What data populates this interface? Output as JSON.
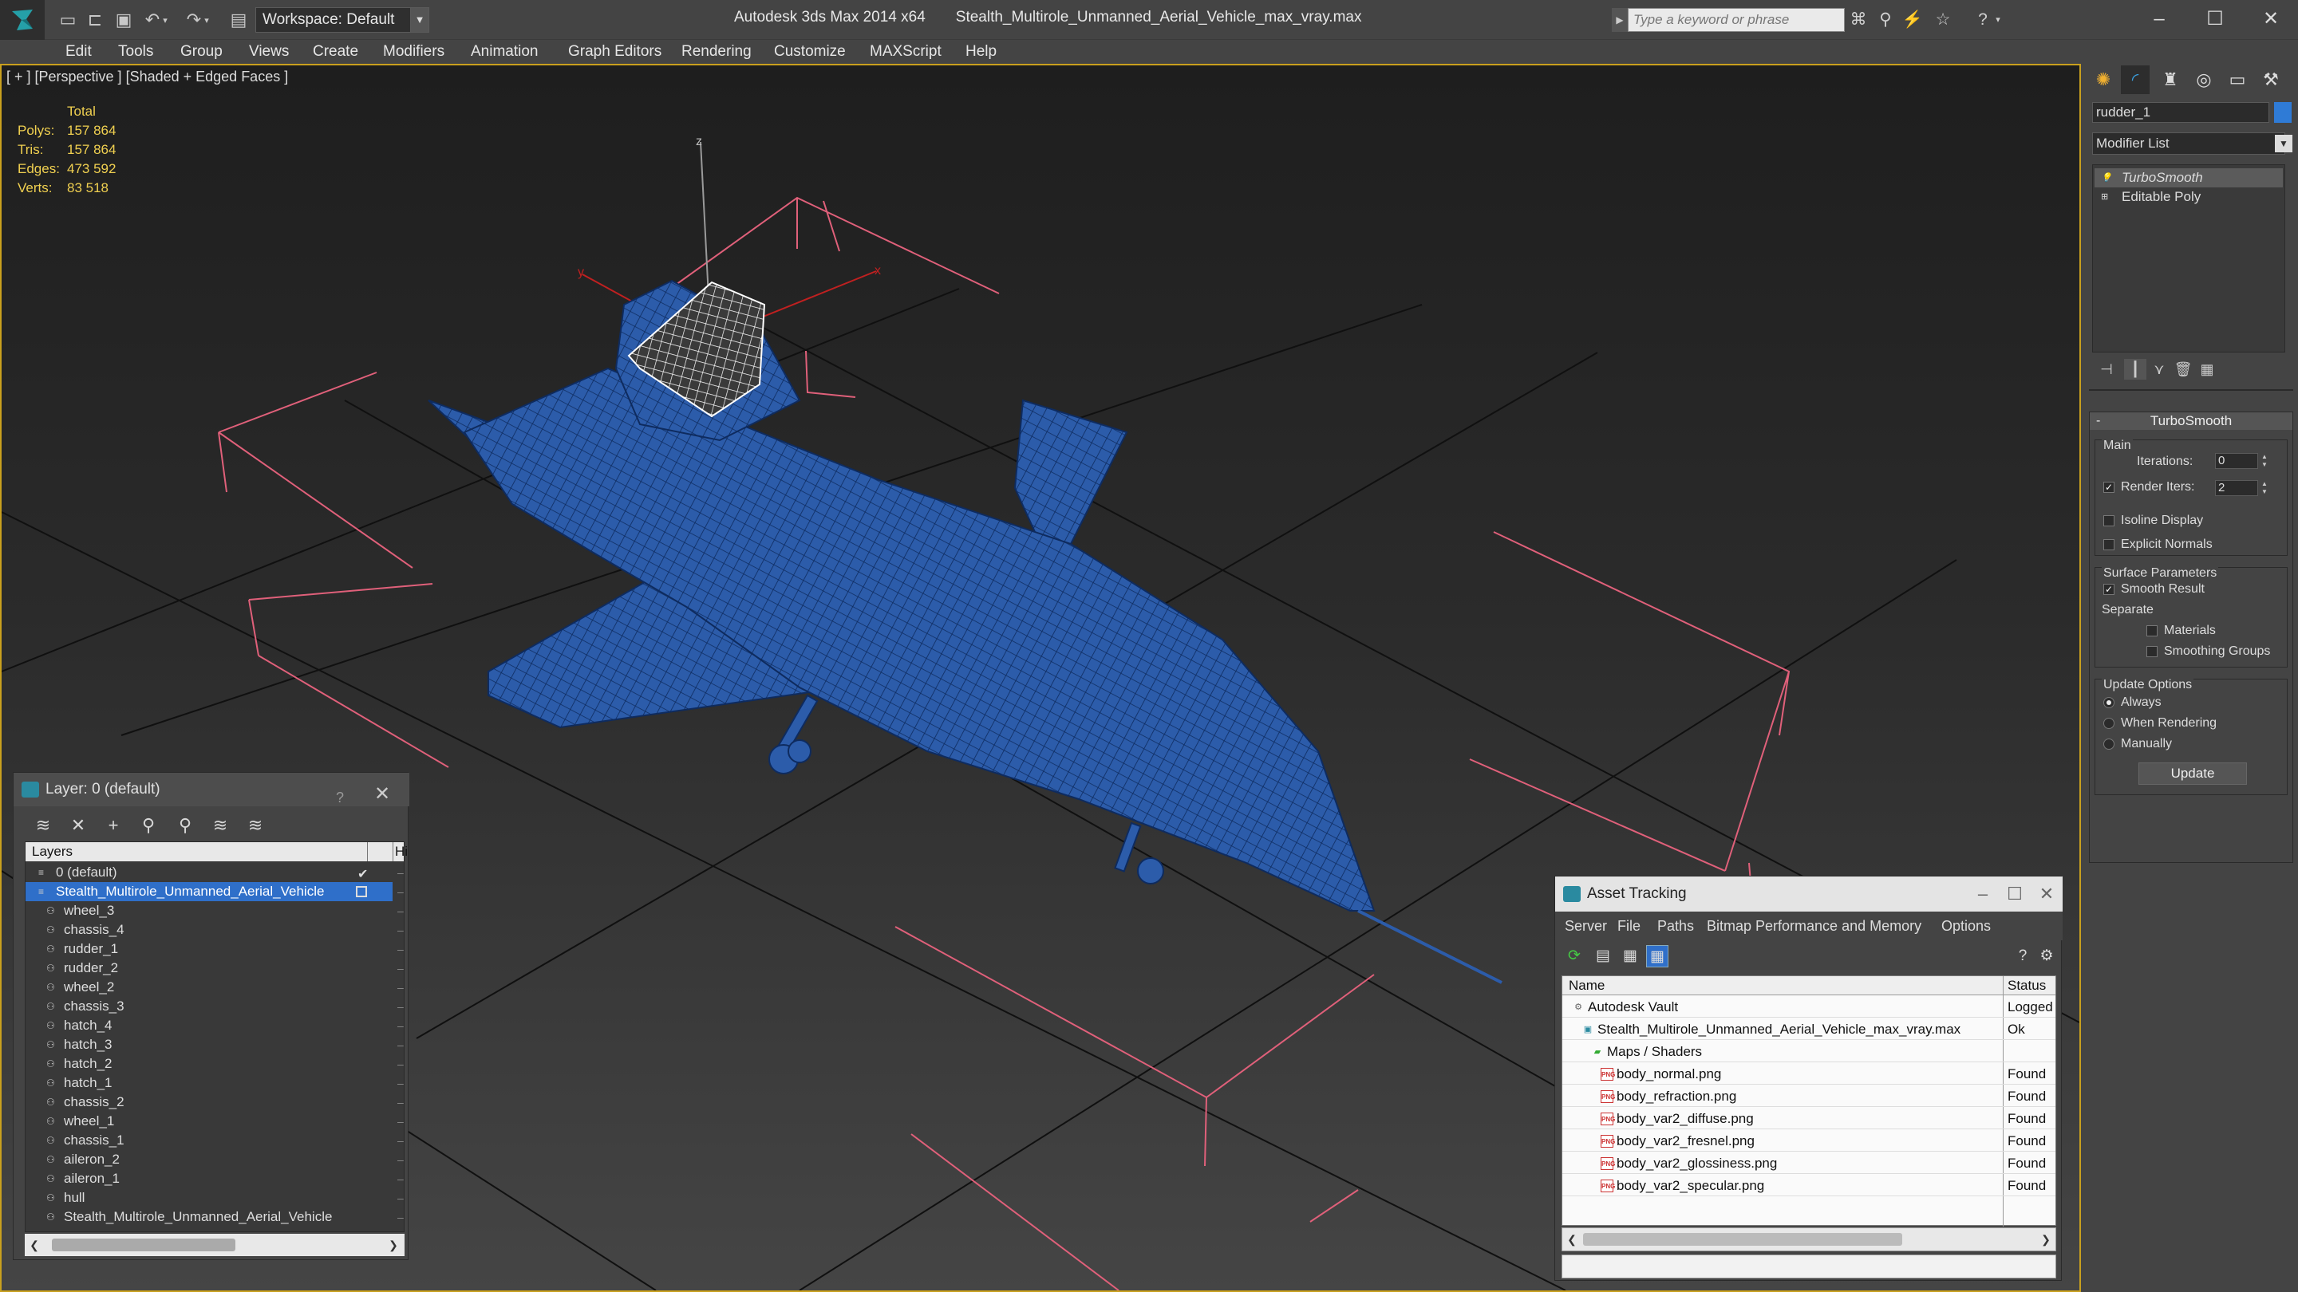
{
  "titlebar": {
    "workspace_label": "Workspace: Default",
    "app_name": "Autodesk 3ds Max  2014 x64",
    "file_name": "Stealth_Multirole_Unmanned_Aerial_Vehicle_max_vray.max",
    "search_placeholder": "Type a keyword or phrase"
  },
  "menu": {
    "items": [
      "Edit",
      "Tools",
      "Group",
      "Views",
      "Create",
      "Modifiers",
      "Animation",
      "Graph Editors",
      "Rendering",
      "Customize",
      "MAXScript",
      "Help"
    ]
  },
  "viewport": {
    "label": "[ + ] [Perspective ] [Shaded + Edged Faces ]",
    "stats": {
      "header": "Total",
      "polys_label": "Polys:",
      "polys": "157 864",
      "tris_label": "Tris:",
      "tris": "157 864",
      "edges_label": "Edges:",
      "edges": "473 592",
      "verts_label": "Verts:",
      "verts": "83 518"
    },
    "axis_labels": {
      "z": "z",
      "y": "y",
      "x": "x"
    },
    "colors": {
      "model": "#2a5aa8",
      "wire": "#0d2a5e",
      "grid": "#101010",
      "box": "#e0607a",
      "selected": "#ffffff"
    }
  },
  "layer_panel": {
    "title": "Layer: 0 (default)",
    "help": "?",
    "col_layers": "Layers",
    "col_hide": "Hi",
    "rows": [
      {
        "label": "0 (default)",
        "level": 0,
        "type": "layer"
      },
      {
        "label": "Stealth_Multirole_Unmanned_Aerial_Vehicle",
        "level": 0,
        "type": "layer",
        "selected": true
      },
      {
        "label": "wheel_3",
        "level": 1,
        "type": "object"
      },
      {
        "label": "chassis_4",
        "level": 1,
        "type": "object"
      },
      {
        "label": "rudder_1",
        "level": 1,
        "type": "object"
      },
      {
        "label": "rudder_2",
        "level": 1,
        "type": "object"
      },
      {
        "label": "wheel_2",
        "level": 1,
        "type": "object"
      },
      {
        "label": "chassis_3",
        "level": 1,
        "type": "object"
      },
      {
        "label": "hatch_4",
        "level": 1,
        "type": "object"
      },
      {
        "label": "hatch_3",
        "level": 1,
        "type": "object"
      },
      {
        "label": "hatch_2",
        "level": 1,
        "type": "object"
      },
      {
        "label": "hatch_1",
        "level": 1,
        "type": "object"
      },
      {
        "label": "chassis_2",
        "level": 1,
        "type": "object"
      },
      {
        "label": "wheel_1",
        "level": 1,
        "type": "object"
      },
      {
        "label": "chassis_1",
        "level": 1,
        "type": "object"
      },
      {
        "label": "aileron_2",
        "level": 1,
        "type": "object"
      },
      {
        "label": "aileron_1",
        "level": 1,
        "type": "object"
      },
      {
        "label": "hull",
        "level": 1,
        "type": "object"
      },
      {
        "label": "Stealth_Multirole_Unmanned_Aerial_Vehicle",
        "level": 1,
        "type": "object"
      }
    ]
  },
  "asset_tracking": {
    "title": "Asset Tracking",
    "menu": [
      "Server",
      "File",
      "Paths",
      "Bitmap Performance and Memory",
      "Options"
    ],
    "col_name": "Name",
    "col_status": "Status",
    "rows": [
      {
        "name": "Autodesk Vault",
        "status": "Logged",
        "level": 0,
        "icon": "vault-icon"
      },
      {
        "name": "Stealth_Multirole_Unmanned_Aerial_Vehicle_max_vray.max",
        "status": "Ok",
        "level": 1,
        "icon": "max-file-icon"
      },
      {
        "name": "Maps / Shaders",
        "status": "",
        "level": 2,
        "icon": "maps-icon"
      },
      {
        "name": "body_normal.png",
        "status": "Found",
        "level": 3,
        "icon": "png-icon"
      },
      {
        "name": "body_refraction.png",
        "status": "Found",
        "level": 3,
        "icon": "png-icon"
      },
      {
        "name": "body_var2_diffuse.png",
        "status": "Found",
        "level": 3,
        "icon": "png-icon"
      },
      {
        "name": "body_var2_fresnel.png",
        "status": "Found",
        "level": 3,
        "icon": "png-icon"
      },
      {
        "name": "body_var2_glossiness.png",
        "status": "Found",
        "level": 3,
        "icon": "png-icon"
      },
      {
        "name": "body_var2_specular.png",
        "status": "Found",
        "level": 3,
        "icon": "png-icon"
      }
    ]
  },
  "command_panel": {
    "object_name": "rudder_1",
    "modifier_list": "Modifier List",
    "stack": [
      {
        "label": "TurboSmooth",
        "selected": true
      },
      {
        "label": "Editable Poly",
        "selected": false
      }
    ],
    "rollout_title": "TurboSmooth",
    "main_group": "Main",
    "iterations_label": "Iterations:",
    "iterations_value": "0",
    "render_iters_label": "Render Iters:",
    "render_iters_value": "2",
    "render_iters_checked": true,
    "isoline_label": "Isoline Display",
    "explicit_normals_label": "Explicit Normals",
    "surface_group": "Surface Parameters",
    "smooth_result_label": "Smooth Result",
    "separate_label": "Separate",
    "materials_label": "Materials",
    "smoothing_groups_label": "Smoothing Groups",
    "update_group": "Update Options",
    "always_label": "Always",
    "when_rendering_label": "When Rendering",
    "manually_label": "Manually",
    "update_button": "Update"
  }
}
